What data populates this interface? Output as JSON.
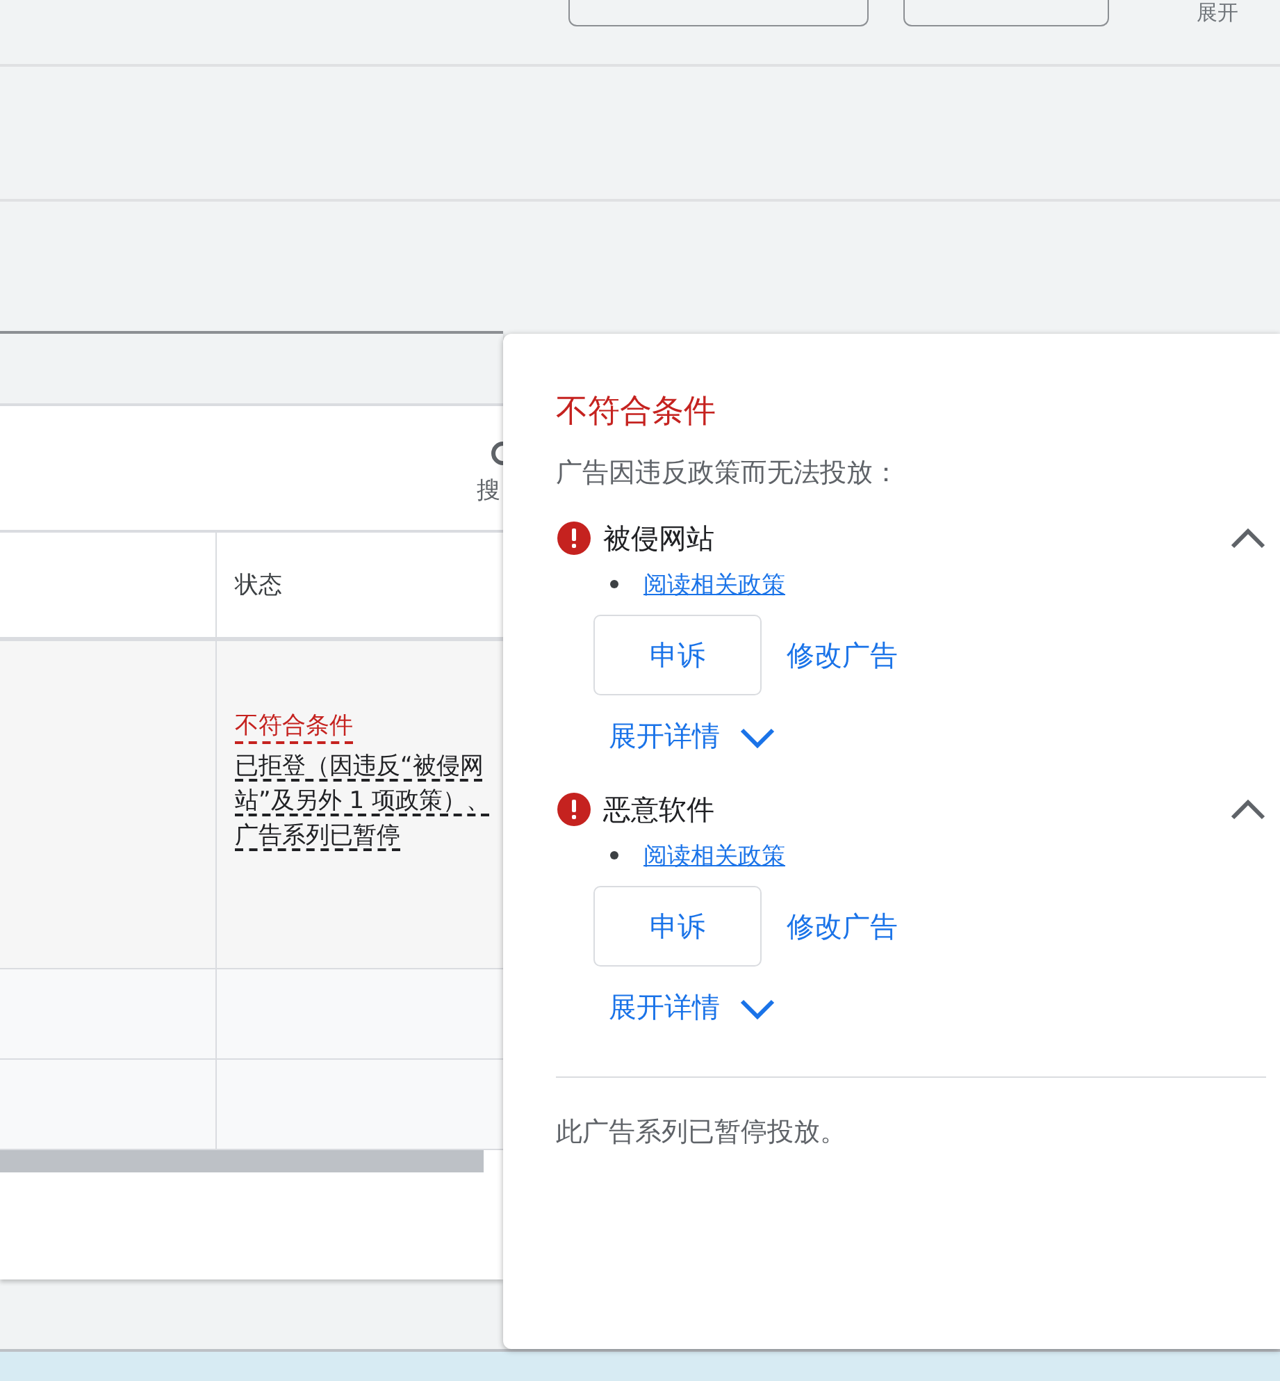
{
  "top_bar": {
    "expand_label": "展开"
  },
  "table": {
    "search_label": "搜",
    "columns": [
      {
        "label": "状态"
      }
    ],
    "rows": [
      {
        "status": "不符合条件",
        "detail": "已拒登（因违反“被侵网站”及另外 1 项政策）、广告系列已暂停"
      }
    ]
  },
  "popup": {
    "title": "不符合条件",
    "subtitle": "广告因违反政策而无法投放：",
    "issues": [
      {
        "title": "被侵网站",
        "expanded": true,
        "link": "阅读相关政策",
        "appeal": "申诉",
        "edit": "修改广告",
        "details": "展开详情"
      },
      {
        "title": "恶意软件",
        "expanded": true,
        "link": "阅读相关政策",
        "appeal": "申诉",
        "edit": "修改广告",
        "details": "展开详情"
      }
    ],
    "footer": "此广告系列已暂停投放。"
  }
}
